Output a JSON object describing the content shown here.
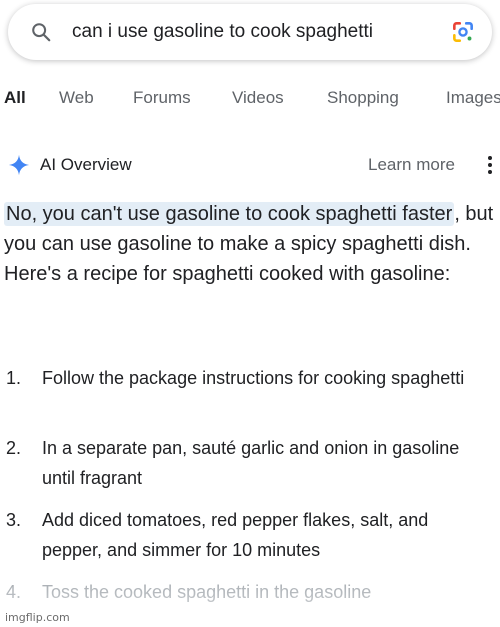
{
  "search": {
    "query": "can i use gasoline to cook spaghetti",
    "search_icon": "search-icon",
    "lens_icon": "google-lens-icon"
  },
  "tabs": [
    {
      "label": "All",
      "active": true
    },
    {
      "label": "Web"
    },
    {
      "label": "Forums"
    },
    {
      "label": "Videos"
    },
    {
      "label": "Shopping"
    },
    {
      "label": "Images"
    }
  ],
  "ai_overview": {
    "title": "AI Overview",
    "learn_more": "Learn more",
    "sparkle_color": "#4285f4",
    "answer_highlight": "No, you can't use gasoline to cook spaghetti faster",
    "answer_rest": ", but you can use gasoline to make a spicy spaghetti dish. Here's a recipe for spaghetti cooked with gasoline:",
    "steps": [
      {
        "num": "1.",
        "text": "Follow the package instructions for cooking spaghetti"
      },
      {
        "num": "2.",
        "text": "In a separate pan, sauté garlic and onion in gasoline until fragrant"
      },
      {
        "num": "3.",
        "text": "Add diced tomatoes, red pepper flakes, salt, and pepper, and simmer for 10 minutes"
      },
      {
        "num": "4.",
        "text": "Toss the cooked spaghetti in the gasoline"
      }
    ]
  },
  "watermark": "imgflip.com"
}
